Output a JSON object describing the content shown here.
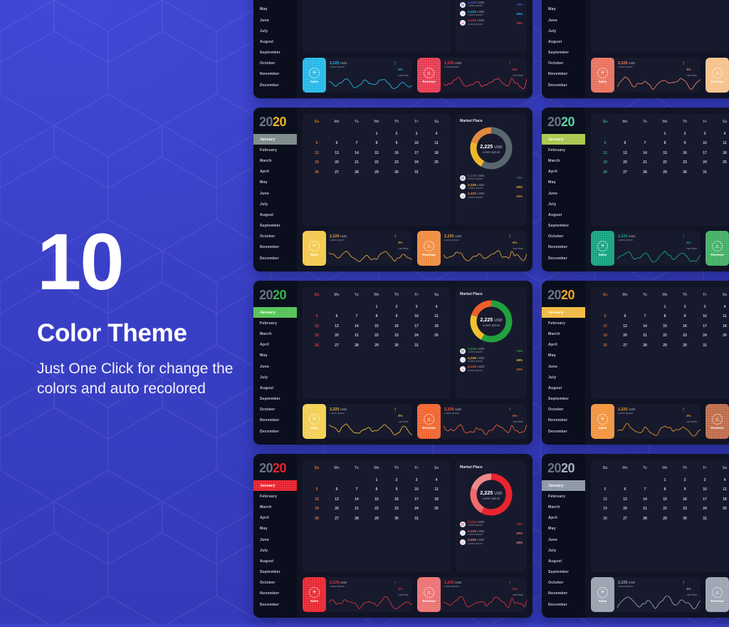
{
  "background": {
    "color": "#3b41c9",
    "pattern": "hexagon-outline"
  },
  "promo": {
    "number": "10",
    "heading": "Color Theme",
    "subtext": "Just One Click for change the colors and auto recolored"
  },
  "dashboard_common": {
    "logo_part1": "20",
    "logo_part2": "20",
    "months": [
      "January",
      "February",
      "March",
      "April",
      "May",
      "June",
      "July",
      "August",
      "September",
      "October",
      "November",
      "December"
    ],
    "active_month": "January",
    "calendar": {
      "weekdays": [
        "Su",
        "Mo",
        "Tu",
        "We",
        "Th",
        "Fr",
        "Sa"
      ],
      "leading_blanks": 3,
      "days": [
        1,
        2,
        3,
        4,
        5,
        6,
        7,
        8,
        9,
        10,
        11,
        12,
        13,
        14,
        15,
        16,
        17,
        18,
        19,
        20,
        21,
        22,
        23,
        24,
        25,
        26,
        27,
        28,
        29,
        30,
        31
      ]
    },
    "market": {
      "title": "Market Place",
      "donut_amount": "2,225",
      "donut_currency": "USD",
      "donut_caption": "Lorem Ipsum",
      "rows": [
        {
          "icon": "chart-bar-icon",
          "amount": "2,225",
          "currency": "USD",
          "caption": "Lorem Ipsum",
          "percent": "74%"
        },
        {
          "icon": "chart-line-icon",
          "amount": "2,225",
          "currency": "USD",
          "caption": "Lorem Ipsum",
          "percent": "29%"
        },
        {
          "icon": "chart-pie-icon",
          "amount": "2,225",
          "currency": "USD",
          "caption": "Lorem Ipsum",
          "percent": "19%"
        }
      ]
    },
    "stats": [
      {
        "label": "Sales",
        "icon": "gear-icon",
        "amount": "2,225",
        "currency": "USD",
        "caption": "Lorem Ipsum",
        "arrow": "↑",
        "trend": "3%",
        "trend_label": "Last Week"
      },
      {
        "label": "Revenue",
        "icon": "drop-icon",
        "amount": "2,225",
        "currency": "USD",
        "caption": "Lorem Ipsum",
        "arrow": "↑",
        "trend": "5%",
        "trend_label": "Last Week"
      }
    ]
  },
  "themes": [
    {
      "name": "blue-red",
      "logo": "#4e54e8",
      "accent": "#4e54e8",
      "accent2": "#23b7e8",
      "accent3": "#e8384f",
      "sun": "#e8384f",
      "d1": "#4e54e8",
      "d2": "#23b7e8",
      "d3": "#e8384f",
      "b1": "#23b7e8",
      "b2": "#e8384f",
      "spark1": "#23b7e8",
      "spark2": "#e8384f"
    },
    {
      "name": "coral",
      "logo": "#e8705c",
      "accent": "#d06a55",
      "accent2": "#f0a868",
      "accent3": "#e8835c",
      "sun": "#e89050",
      "d1": "#e8705c",
      "d2": "#f0a868",
      "d3": "#e8835c",
      "b1": "#e8705c",
      "b2": "#f6c18a",
      "spark1": "#e8835c",
      "spark2": "#e8a15c"
    },
    {
      "name": "gold-slate",
      "logo": "#f0b429",
      "accent": "#7d8a8a",
      "accent2": "#f0b429",
      "accent3": "#e08b3e",
      "sun": "#d9762b",
      "d1": "#59686e",
      "d2": "#f0b429",
      "d3": "#e08b3e",
      "b1": "#f3c94a",
      "b2": "#f08a3c",
      "spark1": "#e0a23c",
      "spark2": "#e0a23c"
    },
    {
      "name": "green-teal",
      "logo": "#5fd3a0",
      "accent": "#a9c84e",
      "accent2": "#14a37f",
      "accent3": "#3fae7c",
      "sun": "#3aa87a",
      "d1": "#14a37f",
      "d2": "#a9c84e",
      "d3": "#3fae7c",
      "b1": "#12a27e",
      "b2": "#3fae62",
      "spark1": "#16a980",
      "spark2": "#2fae6c"
    },
    {
      "name": "green-amber",
      "logo": "#39b54a",
      "accent": "#55c257",
      "accent2": "#f0c030",
      "accent3": "#ef5f2a",
      "sun": "#e8384f",
      "d1": "#22a13e",
      "d2": "#f0c030",
      "d3": "#ef5f2a",
      "b1": "#f3cf52",
      "b2": "#f2622c",
      "spark1": "#e8b63c",
      "spark2": "#e8603c"
    },
    {
      "name": "amber",
      "logo": "#f5a623",
      "accent": "#f0bb44",
      "accent2": "#f08a2c",
      "accent3": "#e0703c",
      "sun": "#c46a2b",
      "d1": "#f5a623",
      "d2": "#f08a2c",
      "d3": "#e0703c",
      "b1": "#f2923c",
      "b2": "#bd6a47",
      "spark1": "#e8902c",
      "spark2": "#e8902c"
    },
    {
      "name": "red",
      "logo": "#e8242f",
      "accent": "#e8242f",
      "accent2": "#ef6a6a",
      "accent3": "#f08a8a",
      "sun": "#e8743c",
      "d1": "#e8242f",
      "d2": "#ef6a6a",
      "d3": "#f08a8a",
      "b1": "#e8242f",
      "b2": "#ec7070",
      "spark1": "#d8353c",
      "spark2": "#d8353c"
    },
    {
      "name": "silver",
      "logo": "#a9b0bd",
      "accent": "#8e97a6",
      "accent2": "#aeb6c3",
      "accent3": "#c6ccd6",
      "sun": "#a9b0bd",
      "d1": "#8e97a6",
      "d2": "#aeb6c3",
      "d3": "#c6ccd6",
      "b1": "#98a0ae",
      "b2": "#9aa2b0",
      "spark1": "#9aa2b0",
      "spark2": "#9aa2b0"
    }
  ]
}
